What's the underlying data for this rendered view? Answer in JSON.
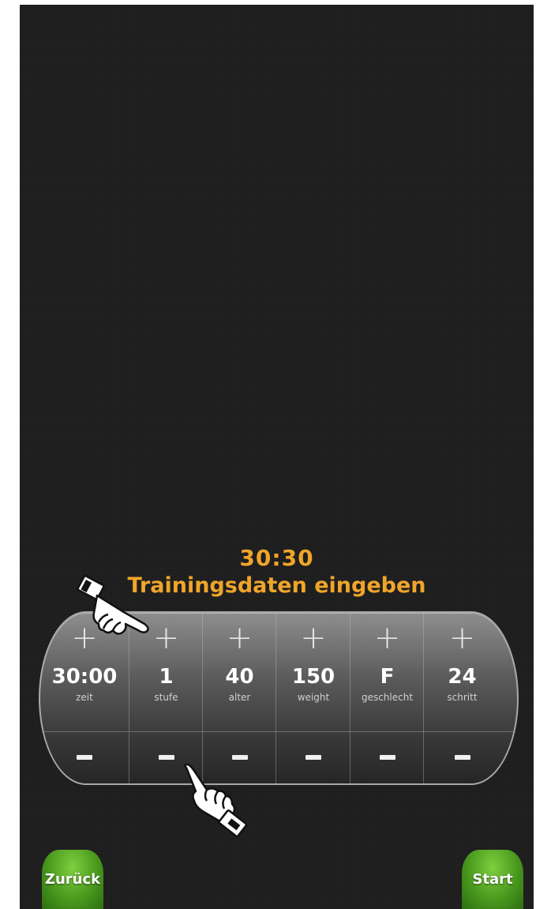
{
  "timer": "30:30",
  "headline": "Trainingsdaten eingeben",
  "controls": [
    {
      "value": "30:00",
      "label": "zeit",
      "plus": "+"
    },
    {
      "value": "1",
      "label": "stufe",
      "plus": "+"
    },
    {
      "value": "40",
      "label": "alter",
      "plus": "+"
    },
    {
      "value": "150",
      "label": "weight",
      "plus": "+"
    },
    {
      "value": "F",
      "label": "geschlecht",
      "plus": "+"
    },
    {
      "value": "24",
      "label": "schritt",
      "plus": "+"
    }
  ],
  "buttons": {
    "back": "Zurück",
    "start": "Start"
  },
  "colors": {
    "accent": "#f0a52a",
    "button_green": "#4a9a1e",
    "background": "#1e1e1e"
  },
  "icons": {
    "pointer_top": "pointing-hand-icon",
    "pointer_bottom": "pointing-hand-icon"
  }
}
